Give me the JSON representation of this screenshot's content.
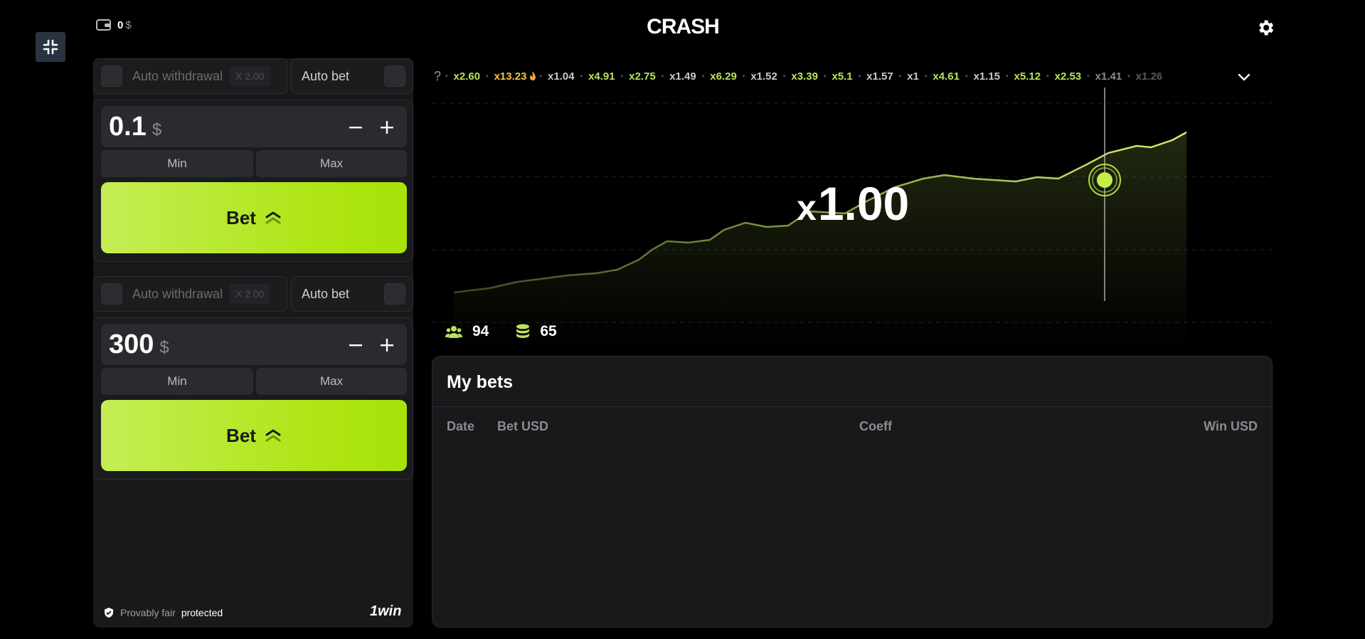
{
  "header": {
    "wallet_amount": "0",
    "wallet_currency": "$",
    "logo_text": "CRASH"
  },
  "bet_panels": [
    {
      "auto_withdrawal_label": "Auto withdrawal",
      "auto_withdrawal_value": "X 2.00",
      "auto_bet_label": "Auto bet",
      "amount": "0.1",
      "currency": "$",
      "min_label": "Min",
      "max_label": "Max",
      "bet_label": "Bet"
    },
    {
      "auto_withdrawal_label": "Auto withdrawal",
      "auto_withdrawal_value": "X 2.00",
      "auto_bet_label": "Auto bet",
      "amount": "300",
      "currency": "$",
      "min_label": "Min",
      "max_label": "Max",
      "bet_label": "Bet"
    }
  ],
  "footer": {
    "provably_label": "Provably fair",
    "protected_label": "protected",
    "brand": "1win"
  },
  "history": {
    "help": "?",
    "items": [
      {
        "v": "x2.60",
        "c": "#b9e25a"
      },
      {
        "v": "x13.23",
        "c": "#f3c247"
      },
      {
        "v": "x1.04",
        "c": "#c8c8c8"
      },
      {
        "v": "x4.91",
        "c": "#b9e25a"
      },
      {
        "v": "x2.75",
        "c": "#b9e25a"
      },
      {
        "v": "x1.49",
        "c": "#c8c8c8"
      },
      {
        "v": "x6.29",
        "c": "#b9e25a"
      },
      {
        "v": "x1.52",
        "c": "#c8c8c8"
      },
      {
        "v": "x3.39",
        "c": "#b9e25a"
      },
      {
        "v": "x5.1",
        "c": "#b9e25a"
      },
      {
        "v": "x1.57",
        "c": "#c8c8c8"
      },
      {
        "v": "x1",
        "c": "#c8c8c8"
      },
      {
        "v": "x4.61",
        "c": "#b9e25a"
      },
      {
        "v": "x1.15",
        "c": "#c8c8c8"
      },
      {
        "v": "x5.12",
        "c": "#b9e25a"
      },
      {
        "v": "x2.53",
        "c": "#b9e25a"
      },
      {
        "v": "x1.41",
        "c": "#8a8a8a"
      },
      {
        "v": "x1.26",
        "c": "#5a5a5a"
      }
    ]
  },
  "game": {
    "multiplier_prefix": "x",
    "multiplier_value": "1.00",
    "players": "94",
    "bets_count": "65",
    "accent_color": "#c4ee4a"
  },
  "my_bets": {
    "title": "My bets",
    "columns": {
      "date": "Date",
      "bet": "Bet USD",
      "coeff": "Coeff",
      "win": "Win USD"
    }
  }
}
